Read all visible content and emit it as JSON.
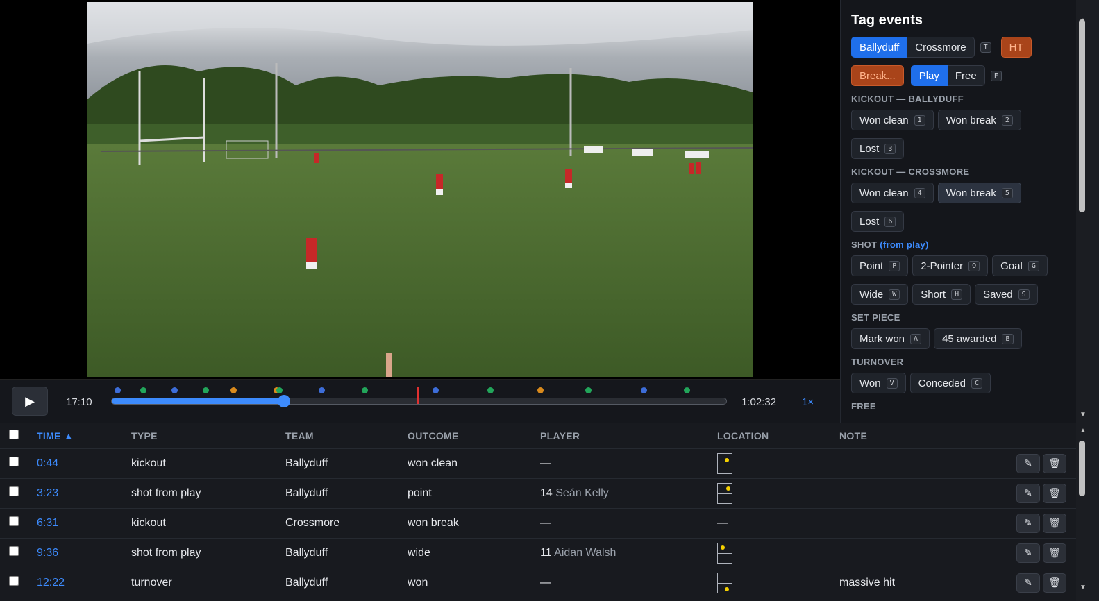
{
  "player": {
    "current_time": "17:10",
    "duration": "1:02:32",
    "speed": "1×",
    "progress": 0.28,
    "current_marker": 0.497,
    "markers": [
      {
        "pos": 0.01,
        "color": "#3d6dd8"
      },
      {
        "pos": 0.052,
        "color": "#22a55a"
      },
      {
        "pos": 0.103,
        "color": "#3d6dd8"
      },
      {
        "pos": 0.153,
        "color": "#22a55a"
      },
      {
        "pos": 0.198,
        "color": "#d98a1c"
      },
      {
        "pos": 0.268,
        "color": "#d98a1c"
      },
      {
        "pos": 0.273,
        "color": "#22a55a"
      },
      {
        "pos": 0.342,
        "color": "#3d6dd8"
      },
      {
        "pos": 0.412,
        "color": "#22a55a"
      },
      {
        "pos": 0.527,
        "color": "#3d6dd8"
      },
      {
        "pos": 0.615,
        "color": "#22a55a"
      },
      {
        "pos": 0.697,
        "color": "#d98a1c"
      },
      {
        "pos": 0.774,
        "color": "#22a55a"
      },
      {
        "pos": 0.865,
        "color": "#3d6dd8"
      },
      {
        "pos": 0.935,
        "color": "#22a55a"
      }
    ]
  },
  "panel": {
    "title": "Tag events",
    "team_a": "Ballyduff",
    "team_b": "Crossmore",
    "team_key": "T",
    "ht": "HT",
    "break": "Break...",
    "play": "Play",
    "free": "Free",
    "free_key": "F",
    "sections": {
      "kickout_a": "KICKOUT — BALLYDUFF",
      "kickout_b": "KICKOUT — CROSSMORE",
      "shot": "SHOT",
      "shot_sub": "(from play)",
      "set_piece": "SET PIECE",
      "turnover": "TURNOVER",
      "free": "FREE"
    },
    "kickout_a_buttons": [
      {
        "label": "Won clean",
        "key": "1"
      },
      {
        "label": "Won break",
        "key": "2"
      },
      {
        "label": "Lost",
        "key": "3"
      }
    ],
    "kickout_b_buttons": [
      {
        "label": "Won clean",
        "key": "4"
      },
      {
        "label": "Won break",
        "key": "5"
      },
      {
        "label": "Lost",
        "key": "6"
      }
    ],
    "shot_buttons": [
      {
        "label": "Point",
        "key": "P"
      },
      {
        "label": "2-Pointer",
        "key": "O"
      },
      {
        "label": "Goal",
        "key": "G"
      },
      {
        "label": "Wide",
        "key": "W"
      },
      {
        "label": "Short",
        "key": "H"
      },
      {
        "label": "Saved",
        "key": "S"
      }
    ],
    "set_piece_buttons": [
      {
        "label": "Mark won",
        "key": "A"
      },
      {
        "label": "45 awarded",
        "key": "B"
      }
    ],
    "turnover_buttons": [
      {
        "label": "Won",
        "key": "V"
      },
      {
        "label": "Conceded",
        "key": "C"
      }
    ]
  },
  "table": {
    "headers": {
      "time": "TIME ▲",
      "type": "TYPE",
      "team": "TEAM",
      "outcome": "OUTCOME",
      "player": "PLAYER",
      "location": "LOCATION",
      "note": "NOTE"
    },
    "rows": [
      {
        "time": "0:44",
        "type": "kickout",
        "team": "Ballyduff",
        "outcome": "won clean",
        "jersey": "",
        "player": "—",
        "note": ""
      },
      {
        "time": "3:23",
        "type": "shot from play",
        "team": "Ballyduff",
        "outcome": "point",
        "jersey": "14",
        "player": "Seán Kelly",
        "note": ""
      },
      {
        "time": "6:31",
        "type": "kickout",
        "team": "Crossmore",
        "outcome": "won break",
        "jersey": "",
        "player": "—",
        "note": ""
      },
      {
        "time": "9:36",
        "type": "shot from play",
        "team": "Ballyduff",
        "outcome": "wide",
        "jersey": "11",
        "player": "Aidan Walsh",
        "note": ""
      },
      {
        "time": "12:22",
        "type": "turnover",
        "team": "Ballyduff",
        "outcome": "won",
        "jersey": "",
        "player": "—",
        "note": "massive hit"
      }
    ],
    "no_location": "—"
  }
}
